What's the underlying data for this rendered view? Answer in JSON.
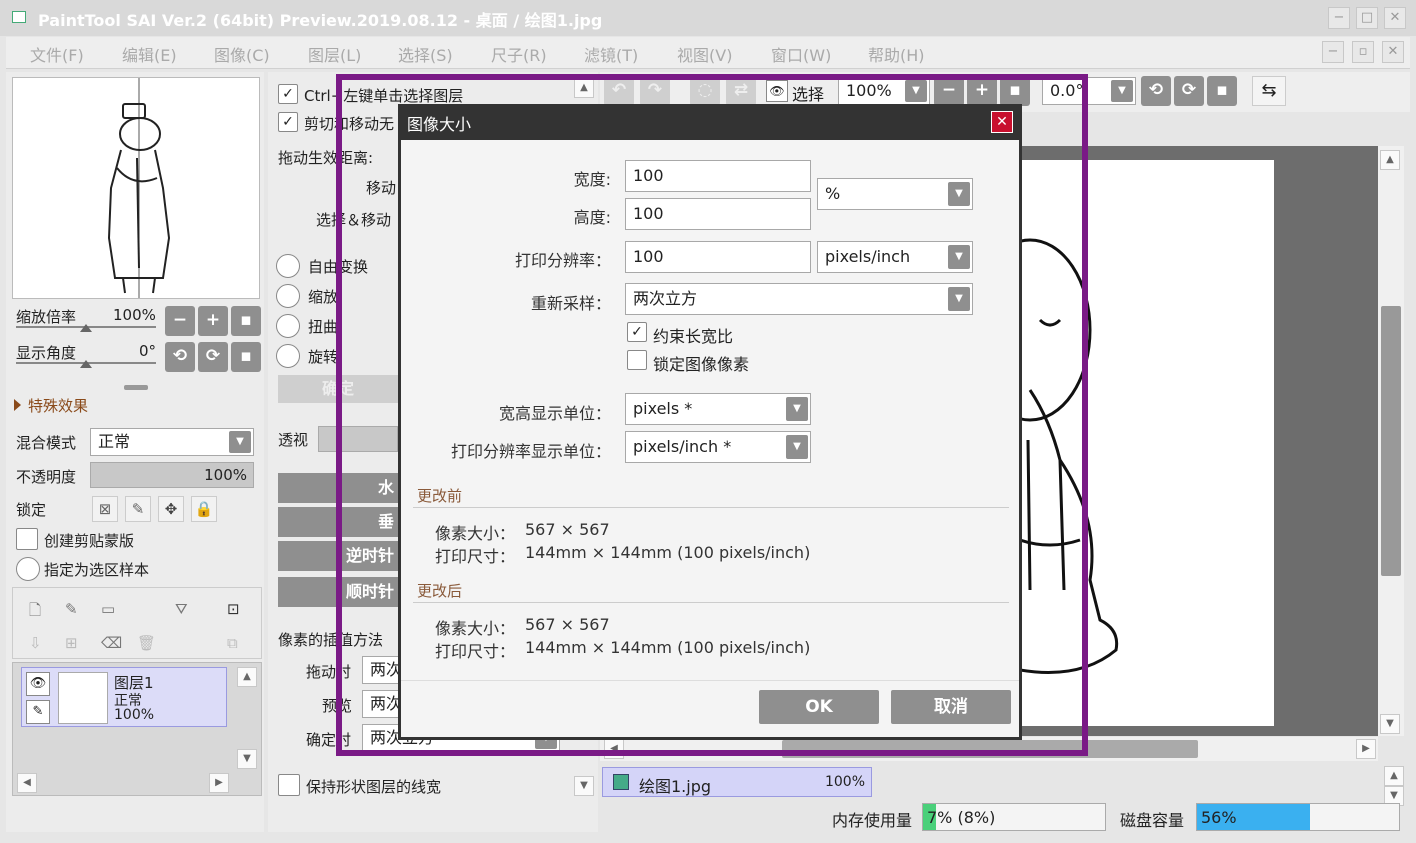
{
  "window": {
    "title": "PaintTool SAI Ver.2 (64bit) Preview.2019.08.12 - 桌面 / 绘图1.jpg"
  },
  "menu": [
    "文件(F)",
    "编辑(E)",
    "图像(C)",
    "图层(L)",
    "选择(S)",
    "尺子(R)",
    "滤镜(T)",
    "视图(V)",
    "窗口(W)",
    "帮助(H)"
  ],
  "navigator": {
    "zoom_label": "缩放倍率",
    "zoom_value": "100%",
    "angle_label": "显示角度",
    "angle_value": "0°"
  },
  "effects_label": "特殊效果",
  "layer_props": {
    "blend_label": "混合模式",
    "blend_value": "正常",
    "opacity_label": "不透明度",
    "opacity_value": "100%",
    "lock_label": "锁定",
    "clip_label": "创建剪贴蒙版",
    "sample_label": "指定为选区样本"
  },
  "layers": [
    {
      "name": "图层1",
      "mode": "正常",
      "opacity": "100%"
    }
  ],
  "tool_options": {
    "ctrl_click": "Ctrl+左键单击选择图层",
    "cut_move": "剪切和移动无",
    "drag_dist": "拖动生效距离:",
    "move": "移动",
    "select_move": "选择＆移动",
    "free_transform": "自由变换",
    "scale": "缩放",
    "distort": "扭曲",
    "rotate": "旋转",
    "ok": "确定",
    "perspective": "透视",
    "btn_h": "水",
    "btn_v": "垂",
    "ccw": "逆时针",
    "cw": "顺时针",
    "interp_label": "像素的插值方法",
    "drag_when": "拖动时",
    "drag_val": "两次",
    "preview": "预览",
    "preview_val": "两次",
    "confirm_when": "确定时",
    "confirm_val": "两次立方",
    "keep_stroke": "保持形状图层的线宽"
  },
  "toolbar": {
    "select_label": "选择",
    "zoom": "100%",
    "angle": "0.0°"
  },
  "document_tab": {
    "name": "绘图1.jpg",
    "zoom": "100%"
  },
  "status": {
    "mem_label": "内存使用量",
    "mem_value": "7% (8%)",
    "mem_fraction": 0.07,
    "disk_label": "磁盘容量",
    "disk_value": "56%",
    "disk_fraction": 0.56
  },
  "dialog": {
    "title": "图像大小",
    "width_label": "宽度:",
    "width_value": "100",
    "height_label": "高度:",
    "height_value": "100",
    "unit_value": "%",
    "res_label": "打印分辨率：",
    "res_value": "100",
    "res_unit": "pixels/inch",
    "resample_label": "重新采样：",
    "resample_value": "两次立方",
    "constrain_label": "约束长宽比",
    "constrain_checked": true,
    "lock_pixels_label": "锁定图像像素",
    "lock_pixels_checked": false,
    "display_unit_label": "宽高显示单位：",
    "display_unit_value": "pixels *",
    "res_display_label": "打印分辨率显示单位：",
    "res_display_value": "pixels/inch *",
    "before_header": "更改前",
    "before_pixel_label": "像素大小：",
    "before_pixel_value": "567 × 567",
    "before_print_label": "打印尺寸：",
    "before_print_value": "144mm × 144mm (100 pixels/inch)",
    "after_header": "更改后",
    "after_pixel_label": "像素大小：",
    "after_pixel_value": "567 × 567",
    "after_print_label": "打印尺寸：",
    "after_print_value": "144mm × 144mm (100 pixels/inch)",
    "ok_label": "OK",
    "cancel_label": "取消"
  }
}
